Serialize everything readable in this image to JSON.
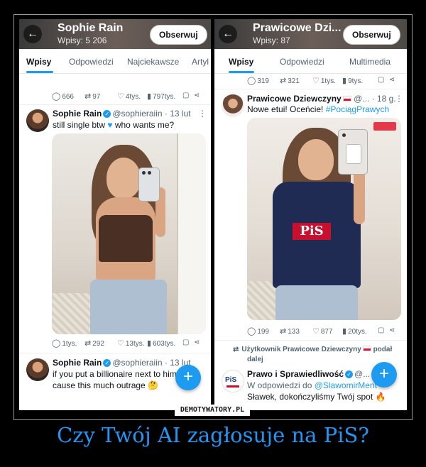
{
  "left_panel": {
    "header": {
      "name": "Sophie Rain",
      "post_count": "Wpisy: 5 206",
      "follow_label": "Obserwuj"
    },
    "tabs": [
      "Wpisy",
      "Odpowiedzi",
      "Najciekawsze",
      "Artyl"
    ],
    "top_actions": {
      "replies": "666",
      "reposts": "97",
      "likes": "4tys.",
      "views": "797tys."
    },
    "post1": {
      "author": "Sophie Rain",
      "handle": "@sophieraiin · 13 lut",
      "text_a": "still single btw",
      "text_b": "who wants me?",
      "actions": {
        "replies": "1tys.",
        "reposts": "292",
        "likes": "13tys.",
        "views": "603tys."
      }
    },
    "post2": {
      "author": "Sophie Rain",
      "handle": "@sophieraiin · 13 lut",
      "line1": "if you put a billionaire next to him",
      "line2": "cause this much outrage"
    }
  },
  "right_panel": {
    "header": {
      "name": "Prawicowe Dzi...",
      "post_count": "Wpisy: 87",
      "follow_label": "Obserwuj"
    },
    "tabs": [
      "Wpisy",
      "Odpowiedzi",
      "Multimedia"
    ],
    "top_actions": {
      "replies": "319",
      "reposts": "321",
      "likes": "1tys.",
      "views": "9tys."
    },
    "post1": {
      "author": "Prawicowe Dziewczyny",
      "handle": "@... · 18 g.",
      "text": "Nowe etui! Oceńcie!",
      "hashtag": "#PociągPrawych",
      "shirt_logo": "PiS",
      "actions": {
        "replies": "199",
        "reposts": "133",
        "likes": "877",
        "views": "20tys."
      }
    },
    "repost_line": "Użytkownik Prawicowe Dziewczyny",
    "repost_suffix": "podał",
    "repost_line2": "dalej",
    "post2": {
      "author": "Prawo i Sprawiedliwość",
      "handle": "@...",
      "reply_prefix": "W odpowiedzi do",
      "reply_to": "@SlawomirMent",
      "text": "Sławek, dokończyliśmy Twój spot"
    },
    "pis_avatar_text": "PiS"
  },
  "icons": {
    "reply": "reply-icon",
    "repost": "repost-icon",
    "like": "heart-icon",
    "views": "views-icon",
    "bookmark": "bookmark-icon",
    "share": "share-icon"
  },
  "fab_label": "+",
  "watermark": "DEMOTYWATORY.PL",
  "caption": "Czy Twój AI zagłosuje na PiS?",
  "colors": {
    "accent": "#1d9bf0",
    "caption": "#2196f3",
    "pis_red": "#c8102e"
  }
}
